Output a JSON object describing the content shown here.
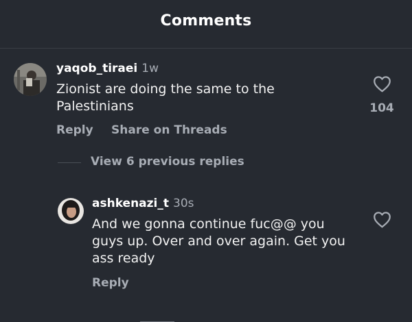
{
  "header": {
    "title": "Comments"
  },
  "comments": [
    {
      "username": "yaqob_tiraei",
      "time": "1w",
      "text": "Zionist are doing the same to the Palestinians",
      "likes": "104",
      "actions": {
        "reply": "Reply",
        "share": "Share on Threads"
      },
      "avatar_icon": "user-photo-avatar"
    }
  ],
  "view_replies": "View 6 previous replies",
  "replies": [
    {
      "username": "ashkenazi_t",
      "time": "30s",
      "text": "And we gonna continue fuc@@ you guys up. Over and over again. Get you ass ready",
      "actions": {
        "reply": "Reply"
      },
      "avatar_icon": "user-photo-avatar"
    }
  ],
  "icons": {
    "like": "heart-outline-icon"
  },
  "colors": {
    "background": "#262a31",
    "text": "#f2f2f2",
    "muted": "#a8adb5"
  }
}
